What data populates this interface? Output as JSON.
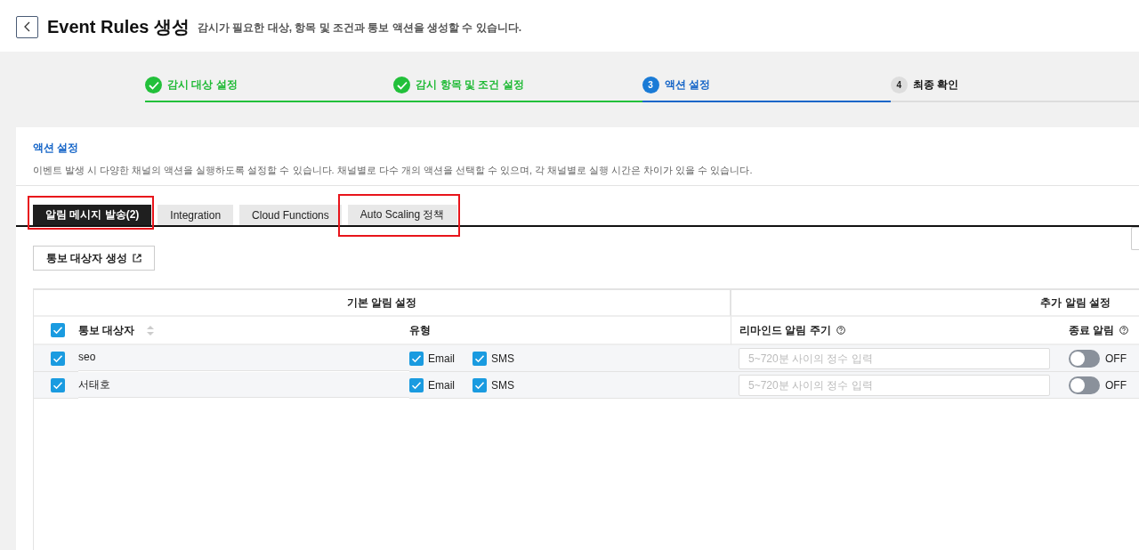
{
  "header": {
    "title": "Event Rules 생성",
    "subtitle": "감시가 필요한 대상, 항목 및 조건과 통보 액션을 생성할 수 있습니다."
  },
  "steps": [
    {
      "label": "감시 대상 설정",
      "done": true,
      "current": false
    },
    {
      "label": "감시 항목 및 조건 설정",
      "done": true,
      "current": false
    },
    {
      "number": "3",
      "label": "액션 설정",
      "done": false,
      "current": true
    },
    {
      "number": "4",
      "label": "최종 확인",
      "done": false,
      "current": false
    }
  ],
  "section": {
    "title": "액션 설정",
    "description": "이벤트 발생 시 다양한 채널의 액션을 실행하도록 설정할 수 있습니다. 채널별로 다수 개의 액션을 선택할 수 있으며, 각 채널별로 실행 시간은 차이가 있을 수 있습니다."
  },
  "tabs": [
    {
      "label": "알림 메시지 발송(2)",
      "selected": true,
      "highlighted": true
    },
    {
      "label": "Integration",
      "selected": false,
      "highlighted": false
    },
    {
      "label": "Cloud Functions",
      "selected": false,
      "highlighted": false
    },
    {
      "label": "Auto Scaling 정책",
      "selected": false,
      "highlighted": true
    }
  ],
  "create_button": "통보 대상자 생성",
  "table": {
    "groups": [
      "기본 알림 설정",
      "추가 알림 설정"
    ],
    "select_all": {
      "checked": true
    },
    "columns": [
      "통보 대상자",
      "유형",
      "리마인드 알림 주기",
      "종료 알림"
    ],
    "rows": [
      {
        "checked": true,
        "name": "seo",
        "types": [
          {
            "label": "Email",
            "checked": true
          },
          {
            "label": "SMS",
            "checked": true
          }
        ],
        "reminder": {
          "placeholder": "5~720분 사이의 정수 입력"
        },
        "end_alert": {
          "on": false,
          "label": "OFF"
        }
      },
      {
        "checked": true,
        "name": "서태호",
        "types": [
          {
            "label": "Email",
            "checked": true
          },
          {
            "label": "SMS",
            "checked": true
          }
        ],
        "reminder": {
          "placeholder": "5~720분 사이의 정수 입력"
        },
        "end_alert": {
          "on": false,
          "label": "OFF"
        }
      }
    ]
  }
}
